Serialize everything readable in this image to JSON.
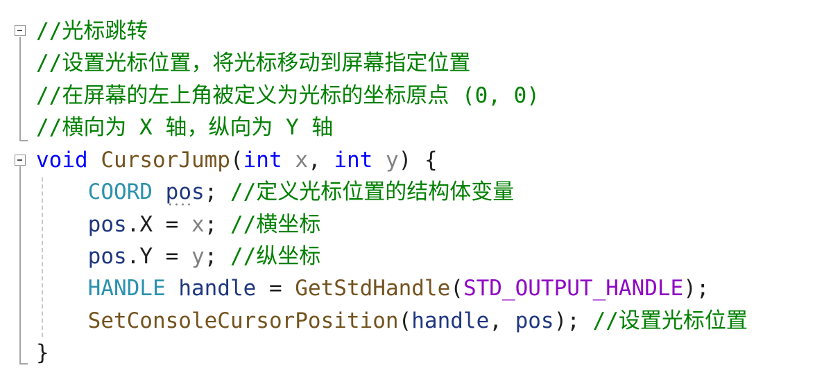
{
  "editor": {
    "lines": [
      [
        {
          "t": "//光标跳转",
          "c": "comment"
        }
      ],
      [
        {
          "t": "//设置光标位置，将光标移动到屏幕指定位置",
          "c": "comment"
        }
      ],
      [
        {
          "t": "//在屏幕的左上角被定义为光标的坐标原点 (0, 0)",
          "c": "comment"
        }
      ],
      [
        {
          "t": "//横向为 X 轴，纵向为 Y 轴",
          "c": "comment"
        }
      ],
      [
        {
          "t": "void",
          "c": "keyword"
        },
        {
          "t": " ",
          "c": "text"
        },
        {
          "t": "CursorJump",
          "c": "func"
        },
        {
          "t": "(",
          "c": "text"
        },
        {
          "t": "int",
          "c": "keyword"
        },
        {
          "t": " ",
          "c": "text"
        },
        {
          "t": "x",
          "c": "param"
        },
        {
          "t": ", ",
          "c": "text"
        },
        {
          "t": "int",
          "c": "keyword"
        },
        {
          "t": " ",
          "c": "text"
        },
        {
          "t": "y",
          "c": "param"
        },
        {
          "t": ") {",
          "c": "text"
        }
      ],
      [
        {
          "t": "    ",
          "c": "text"
        },
        {
          "t": "COORD",
          "c": "type"
        },
        {
          "t": " ",
          "c": "text"
        },
        {
          "t": "pos",
          "c": "local"
        },
        {
          "t": "; ",
          "c": "text"
        },
        {
          "t": "//定义光标位置的结构体变量",
          "c": "comment"
        }
      ],
      [
        {
          "t": "    ",
          "c": "text"
        },
        {
          "t": "pos",
          "c": "local"
        },
        {
          "t": ".X = ",
          "c": "text"
        },
        {
          "t": "x",
          "c": "param"
        },
        {
          "t": "; ",
          "c": "text"
        },
        {
          "t": "//横坐标",
          "c": "comment"
        }
      ],
      [
        {
          "t": "    ",
          "c": "text"
        },
        {
          "t": "pos",
          "c": "local"
        },
        {
          "t": ".Y = ",
          "c": "text"
        },
        {
          "t": "y",
          "c": "param"
        },
        {
          "t": "; ",
          "c": "text"
        },
        {
          "t": "//纵坐标",
          "c": "comment"
        }
      ],
      [
        {
          "t": "    ",
          "c": "text"
        },
        {
          "t": "HANDLE",
          "c": "type"
        },
        {
          "t": " ",
          "c": "text"
        },
        {
          "t": "handle",
          "c": "local"
        },
        {
          "t": " = ",
          "c": "text"
        },
        {
          "t": "GetStdHandle",
          "c": "func"
        },
        {
          "t": "(",
          "c": "text"
        },
        {
          "t": "STD_OUTPUT_HANDLE",
          "c": "macro"
        },
        {
          "t": ");",
          "c": "text"
        }
      ],
      [
        {
          "t": "    ",
          "c": "text"
        },
        {
          "t": "SetConsoleCursorPosition",
          "c": "func"
        },
        {
          "t": "(",
          "c": "text"
        },
        {
          "t": "handle",
          "c": "local"
        },
        {
          "t": ", ",
          "c": "text"
        },
        {
          "t": "pos",
          "c": "local"
        },
        {
          "t": "); ",
          "c": "text"
        },
        {
          "t": "//设置光标位置",
          "c": "comment"
        }
      ],
      [
        {
          "t": "}",
          "c": "text"
        }
      ]
    ],
    "colors": {
      "comment": "#008000",
      "keyword": "#0000ff",
      "type": "#2b91af",
      "function": "#74531f",
      "macro": "#8f08c4",
      "parameter": "#808080",
      "local_variable": "#1f377f",
      "text": "#1e1e1e"
    },
    "icons": {
      "fold": "collapse-minus-icon",
      "warning": "squiggle-underline"
    }
  }
}
